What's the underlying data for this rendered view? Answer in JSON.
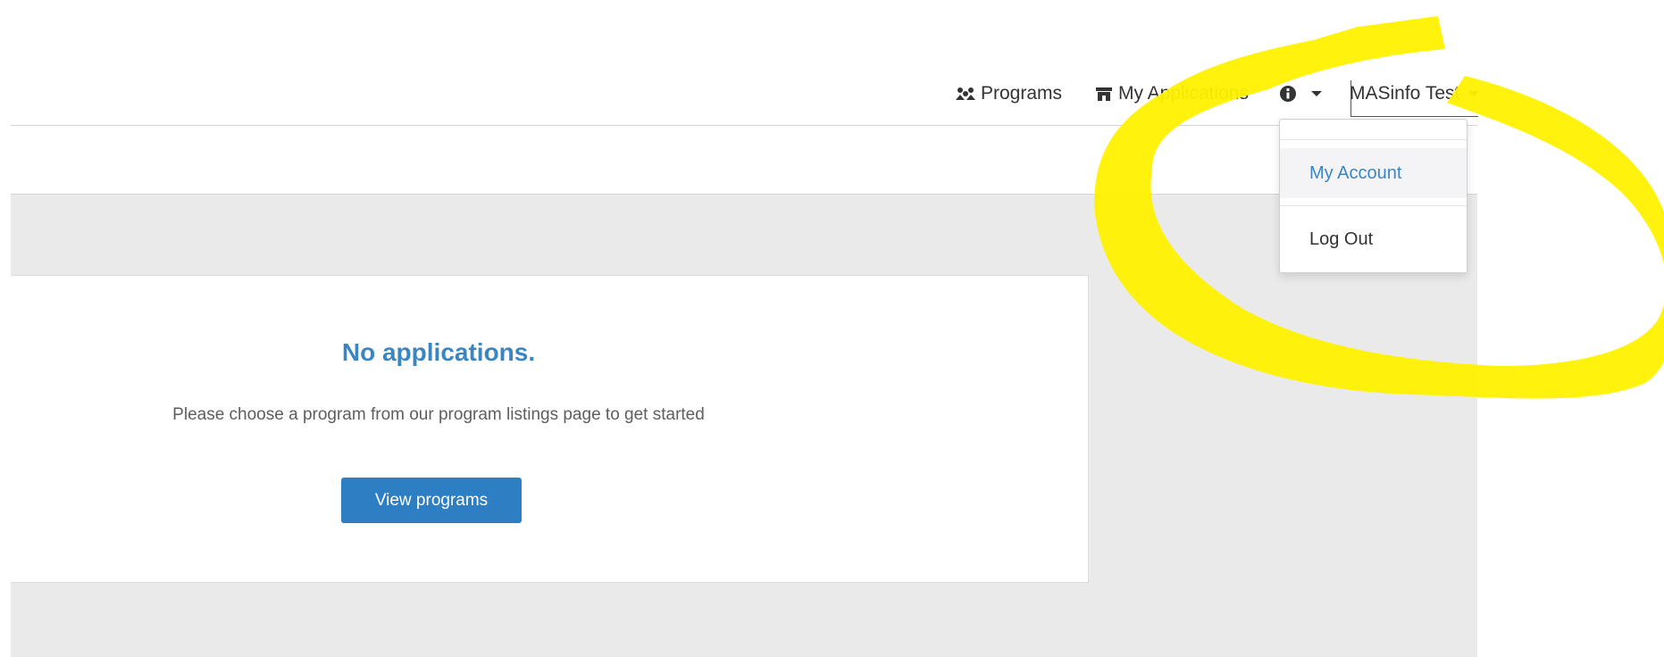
{
  "nav": {
    "programs_label": "Programs",
    "applications_label": "My Applications",
    "user_label": "MASinfo Test"
  },
  "dropdown": {
    "items": [
      {
        "label": "My Account"
      },
      {
        "label": "Log Out"
      }
    ]
  },
  "empty_state": {
    "title": "No applications.",
    "message": "Please choose a program from our program listings page to get started",
    "button_label": "View programs"
  },
  "icons": {
    "programs": "programs-icon",
    "applications": "shop-icon",
    "info": "info-icon",
    "caret": "caret-down-icon"
  },
  "colors": {
    "accent": "#2d7ec2",
    "link": "#3a86c2",
    "highlight": "#fff200",
    "content_bg": "#eaeaea"
  }
}
